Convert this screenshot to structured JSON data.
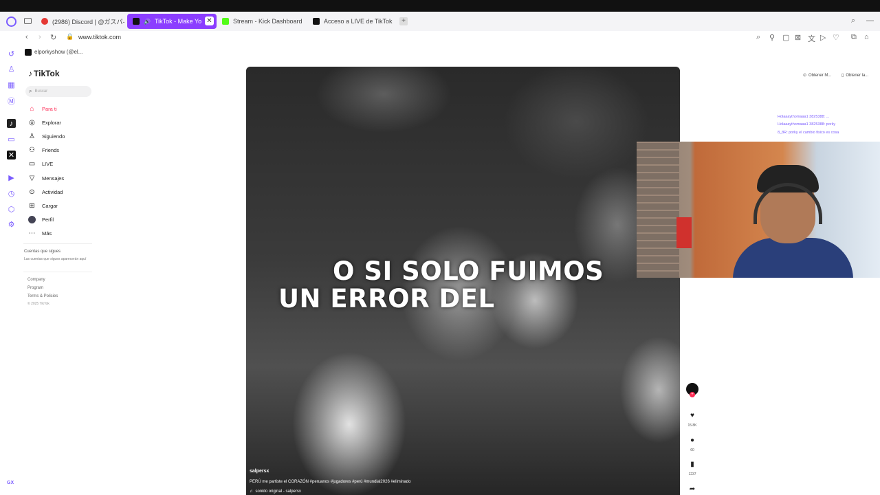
{
  "browser": {
    "tabs": [
      {
        "label": "(2986) Discord | @ガスパ-",
        "active": false
      },
      {
        "label": "TikTok - Make Yo",
        "active": true
      },
      {
        "label": "Stream - Kick Dashboard",
        "active": false
      },
      {
        "label": "Acceso a LIVE de TikTok",
        "active": false
      }
    ],
    "url": "www.tiktok.com",
    "bookmark": "elporkyshow (@el..."
  },
  "tiktok": {
    "logo": "TikTok",
    "search_placeholder": "Buscar",
    "nav": [
      "Para ti",
      "Explorar",
      "Siguiendo",
      "Friends",
      "LIVE",
      "Mensajes",
      "Actividad",
      "Cargar",
      "Perfil",
      "Más"
    ],
    "following_title": "Cuentas que sigues",
    "following_desc": "Las cuentas que sigues aparecerán aquí",
    "footer": [
      "Company",
      "Program",
      "Terms & Policies",
      "© 2025 TikTok"
    ],
    "top_right": [
      "Obtener M...",
      "Obtener la..."
    ],
    "video": {
      "caption_line1": "O SI SOLO FUIMOS",
      "caption_line2": "UN ERROR DEL",
      "author": "salpersx",
      "description": "PERÚ me partiste el CORAZÓN #peruanos #jugadores #perú #mundial2026 #eliminado",
      "sound": "sonido original - salpersx"
    },
    "actions": {
      "likes": "15.8K",
      "comments": "60",
      "saves": "1237"
    }
  },
  "chat": [
    "Holaaaythomaaa1 3825388: ...",
    "Holaaaythomaaa1 3825388: porky",
    "8_8R: porky el cambio fisico es cosa"
  ],
  "colors": {
    "accent": "#8b3dff",
    "tiktok_red": "#fe2c55"
  },
  "status": "GX"
}
